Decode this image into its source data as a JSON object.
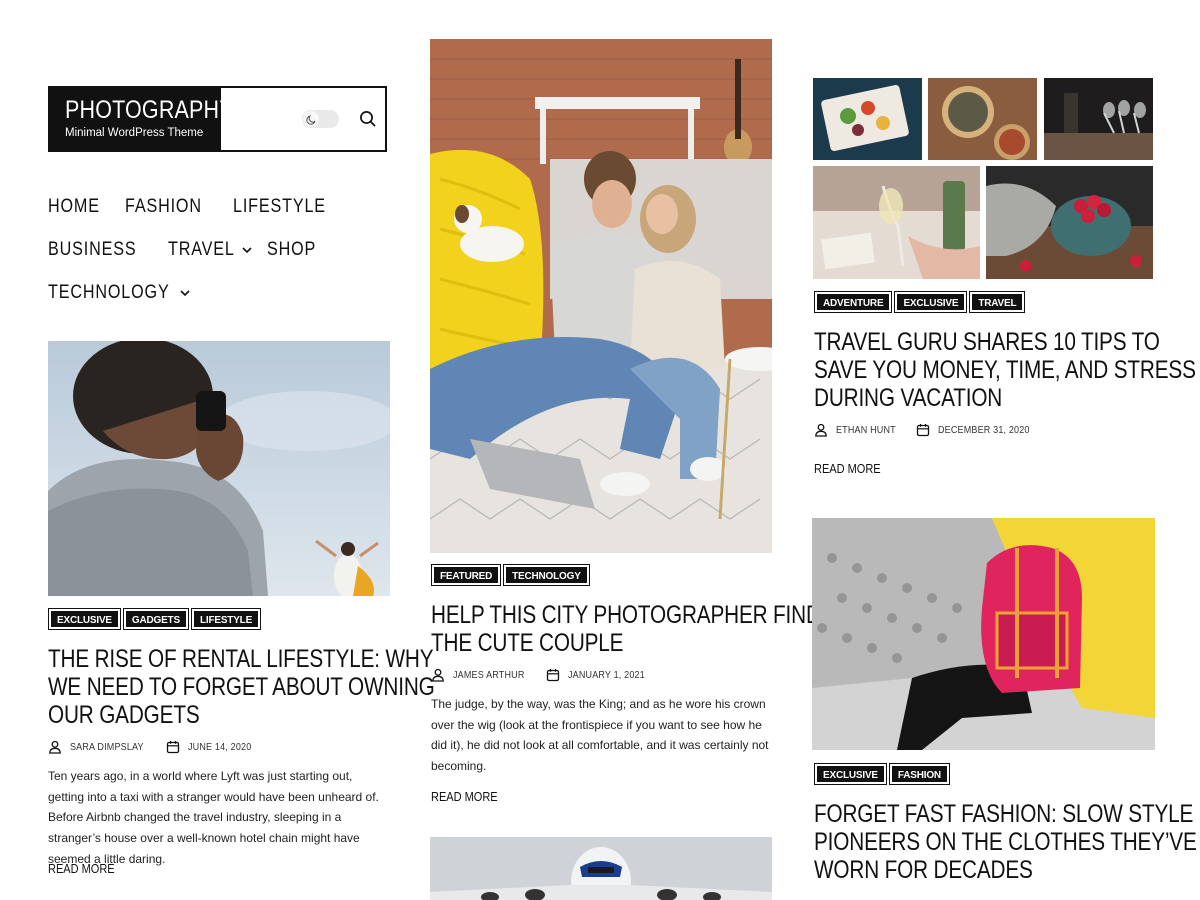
{
  "site": {
    "title": "PHOTOGRAPHY",
    "tagline": "Minimal WordPress Theme"
  },
  "icons": {
    "theme_toggle": "moon-icon",
    "search": "search-icon",
    "author": "user-icon",
    "date": "calendar-icon",
    "dropdown": "chevron-down-icon"
  },
  "nav": {
    "rows": [
      [
        {
          "label": "HOME"
        },
        {
          "label": "FASHION"
        },
        {
          "label": "LIFESTYLE"
        }
      ],
      [
        {
          "label": "BUSINESS"
        },
        {
          "label": "TRAVEL",
          "dropdown": true
        },
        {
          "label": "SHOP"
        }
      ],
      [
        {
          "label": "TECHNOLOGY",
          "dropdown": true
        }
      ]
    ]
  },
  "posts": {
    "rental": {
      "tags": [
        "EXCLUSIVE",
        "GADGETS",
        "LIFESTYLE"
      ],
      "title_lines": [
        "THE RISE OF RENTAL LIFESTYLE: WHY",
        "WE NEED TO FORGET ABOUT OWNING",
        "OUR GADGETS"
      ],
      "author": "SARA DIMPSLAY",
      "date": "JUNE 14, 2020",
      "excerpt": "Ten years ago, in a world where Lyft was just starting out, getting into a taxi with a stranger would have been unheard of. Before Airbnb changed the travel industry, sleeping in a stranger’s house over a well-known hotel chain might have seemed a little daring.",
      "read_more": "READ MORE"
    },
    "couple": {
      "tags": [
        "FEATURED",
        "TECHNOLOGY"
      ],
      "title_lines": [
        "HELP THIS CITY PHOTOGRAPHER FIND",
        "THE CUTE COUPLE"
      ],
      "author": "JAMES ARTHUR",
      "date": "JANUARY 1, 2021",
      "excerpt": "The judge, by the way, was the King; and as he wore his crown over the wig (look at the frontispiece if you want to see how he did it), he did not look at all comfortable, and it was certainly not becoming.",
      "read_more": "READ MORE"
    },
    "travel": {
      "tags": [
        "ADVENTURE",
        "EXCLUSIVE",
        "TRAVEL"
      ],
      "title_lines": [
        "TRAVEL GURU SHARES 10 TIPS TO",
        "SAVE YOU MONEY, TIME, AND STRESS",
        "DURING VACATION"
      ],
      "author": "ETHAN HUNT",
      "date": "DECEMBER 31, 2020",
      "read_more": "READ MORE"
    },
    "fashion": {
      "tags": [
        "EXCLUSIVE",
        "FASHION"
      ],
      "title_lines": [
        "FORGET FAST FASHION: SLOW STYLE",
        "PIONEERS ON THE CLOTHES THEY’VE",
        "WORN FOR DECADES"
      ]
    }
  },
  "colors": {
    "ink": "#111111",
    "tag_bg": "#111111",
    "tag_text": "#ffffff",
    "chair_yellow": "#f2d21c",
    "bag_pink": "#e0245e"
  }
}
